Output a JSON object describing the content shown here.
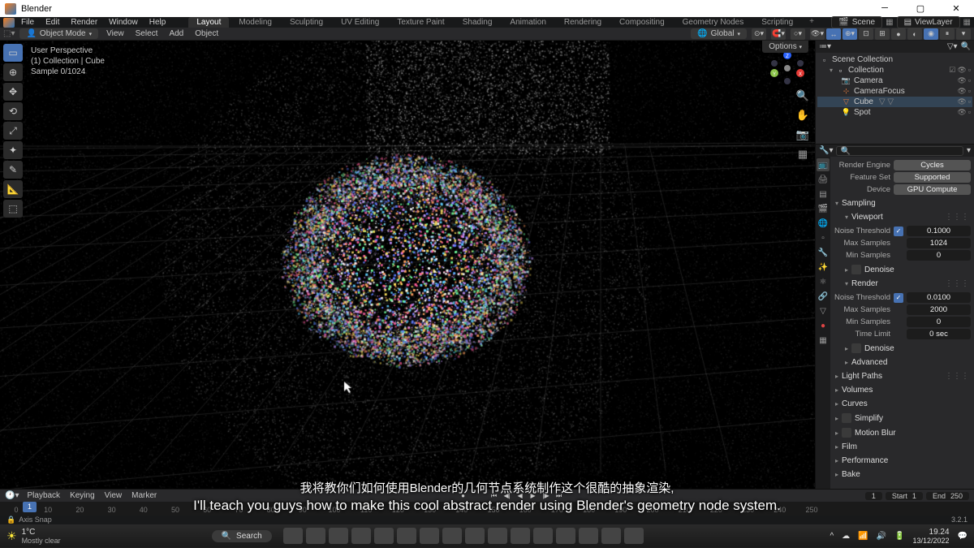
{
  "app_title": "Blender",
  "window_controls": {
    "min": "─",
    "max": "▢",
    "close": "✕"
  },
  "menus": [
    "File",
    "Edit",
    "Render",
    "Window",
    "Help"
  ],
  "workspaces": [
    "Layout",
    "Modeling",
    "Sculpting",
    "UV Editing",
    "Texture Paint",
    "Shading",
    "Animation",
    "Rendering",
    "Compositing",
    "Geometry Nodes",
    "Scripting"
  ],
  "workspace_active": "Layout",
  "scene_name": "Scene",
  "viewlayer_name": "ViewLayer",
  "object_mode": "Object Mode",
  "header_menus": [
    "View",
    "Select",
    "Add",
    "Object"
  ],
  "orientation": "Global",
  "options_label": "Options",
  "viewport_info": {
    "l1": "User Perspective",
    "l2": "(1) Collection | Cube",
    "l3": "Sample 0/1024"
  },
  "outliner": {
    "root": "Scene Collection",
    "collection": "Collection",
    "items": [
      {
        "name": "Camera",
        "icon": "📷",
        "color": "#e87d3e"
      },
      {
        "name": "CameraFocus",
        "icon": "⊹",
        "color": "#e87d3e"
      },
      {
        "name": "Cube",
        "icon": "▽",
        "color": "#e87d3e",
        "selected": true,
        "extra": "▽ ▽"
      },
      {
        "name": "Spot",
        "icon": "💡",
        "color": "#e87d3e"
      }
    ]
  },
  "render_props": {
    "engine_label": "Render Engine",
    "engine": "Cycles",
    "featureset_label": "Feature Set",
    "featureset": "Supported",
    "device_label": "Device",
    "device": "GPU Compute"
  },
  "sections": {
    "sampling": "Sampling",
    "viewport": "Viewport",
    "render": "Render",
    "denoise": "Denoise",
    "advanced": "Advanced",
    "light_paths": "Light Paths",
    "volumes": "Volumes",
    "curves": "Curves",
    "simplify": "Simplify",
    "motion_blur": "Motion Blur",
    "film": "Film",
    "performance": "Performance",
    "bake": "Bake"
  },
  "viewport_sampling": {
    "noise_thresh_label": "Noise Threshold",
    "noise_thresh": "0.1000",
    "max_samples_label": "Max Samples",
    "max_samples": "1024",
    "min_samples_label": "Min Samples",
    "min_samples": "0"
  },
  "render_sampling": {
    "noise_thresh_label": "Noise Threshold",
    "noise_thresh": "0.0100",
    "max_samples_label": "Max Samples",
    "max_samples": "2000",
    "min_samples_label": "Min Samples",
    "min_samples": "0",
    "time_limit_label": "Time Limit",
    "time_limit": "0 sec"
  },
  "timeline": {
    "menus": [
      "Playback",
      "Keying",
      "View",
      "Marker"
    ],
    "current": "1",
    "start_label": "Start",
    "start": "1",
    "end_label": "End",
    "end": "250",
    "ticks": [
      "0",
      "10",
      "20",
      "30",
      "40",
      "50",
      "60",
      "70",
      "80",
      "90",
      "100",
      "110",
      "120",
      "130",
      "140",
      "150",
      "160",
      "170",
      "180",
      "190",
      "200",
      "210",
      "220",
      "230",
      "240",
      "250"
    ]
  },
  "statusbar": {
    "axis_snap": "Axis Snap"
  },
  "taskbar": {
    "temp": "1°C",
    "weather": "Mostly clear",
    "search": "Search",
    "time": "19.24",
    "date": "13/12/2022"
  },
  "subtitles": {
    "cn": "我将教你们如何使用Blender的几何节点系统制作这个很酷的抽象渲染,",
    "en": "I'll teach you guys how to make this cool abstract render using Blender's geometry node system."
  },
  "version_badge": "3.2.1"
}
